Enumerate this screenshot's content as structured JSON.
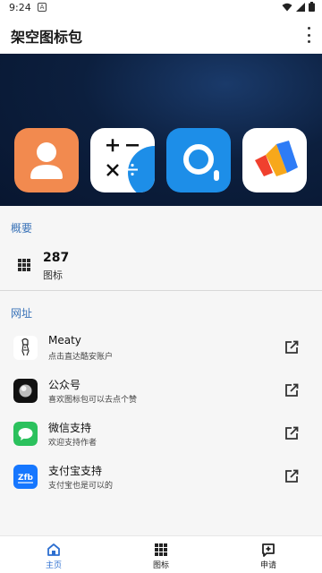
{
  "status_bar": {
    "time": "9:24",
    "notification": "A"
  },
  "app_bar": {
    "title": "架空图标包"
  },
  "banner": {
    "icons": [
      "contacts-icon",
      "calculator-icon",
      "search-app-icon",
      "vivaldi-icon"
    ]
  },
  "overview": {
    "section_title": "概要",
    "count": "287",
    "count_label": "图标"
  },
  "links": {
    "section_title": "网址",
    "items": [
      {
        "title": "Meaty",
        "subtitle": "点击直达酷安账户",
        "icon": "meaty-icon"
      },
      {
        "title": "公众号",
        "subtitle": "喜欢图标包可以去点个赞",
        "icon": "wechat-official-icon"
      },
      {
        "title": "微信支持",
        "subtitle": "欢迎支持作者",
        "icon": "wechat-icon"
      },
      {
        "title": "支付宝支持",
        "subtitle": "支付宝也是可以的",
        "icon": "alipay-icon",
        "icon_text": "Zfb"
      }
    ]
  },
  "bottom_nav": {
    "items": [
      {
        "label": "主页",
        "icon": "home-icon",
        "active": true
      },
      {
        "label": "图标",
        "icon": "grid-icon",
        "active": false
      },
      {
        "label": "申请",
        "icon": "request-icon",
        "active": false
      }
    ]
  },
  "colors": {
    "accent": "#3a73b8",
    "active_nav": "#2d6fd0",
    "banner_bg": "#0c1f3e",
    "contacts": "#f28a4f",
    "search_app": "#1d8ee8",
    "wechat": "#2bc15d",
    "alipay": "#1677ff"
  }
}
